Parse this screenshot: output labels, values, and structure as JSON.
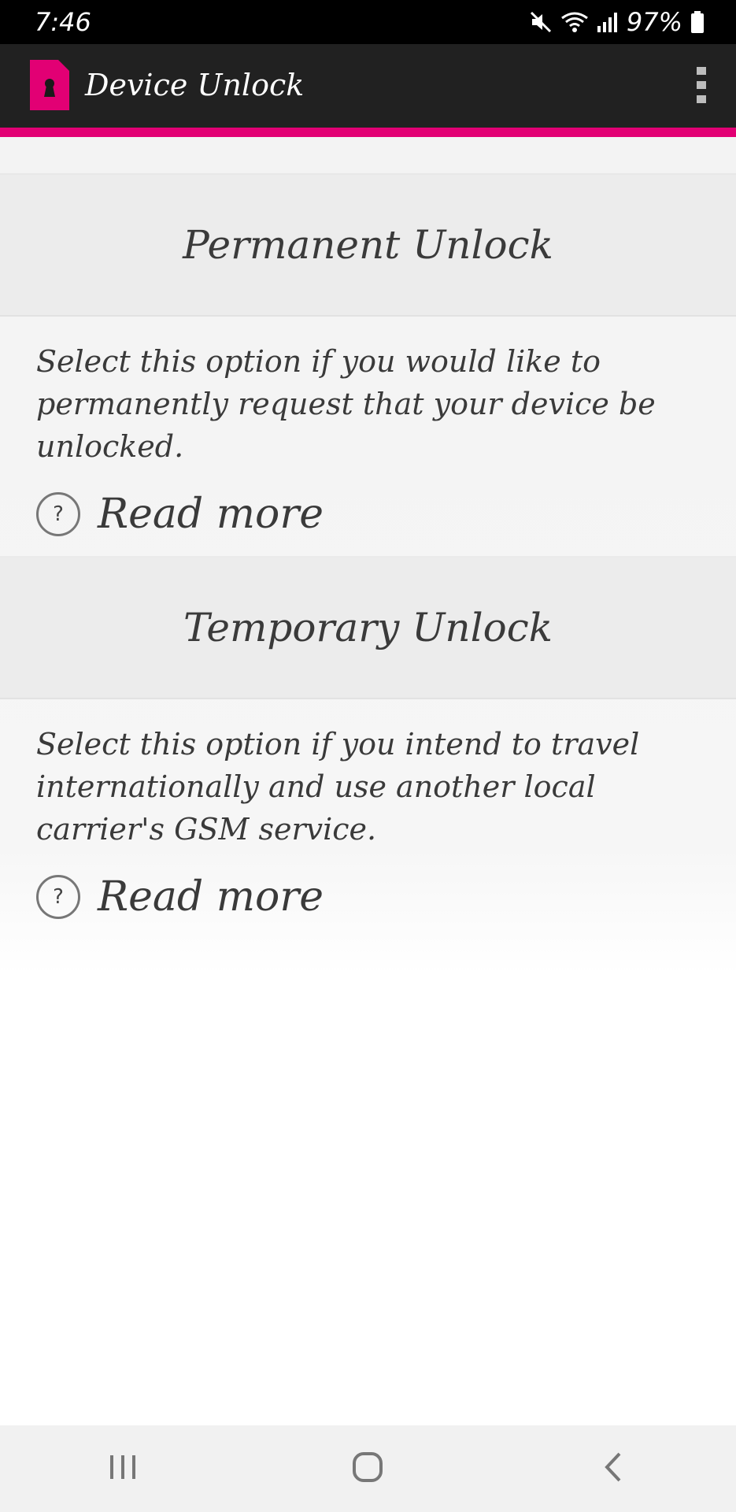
{
  "status_bar": {
    "time": "7:46",
    "battery": "97%",
    "icons": [
      "mute-icon",
      "wifi-icon",
      "signal-icon",
      "battery-icon"
    ]
  },
  "app_bar": {
    "title": "Device Unlock",
    "logo_icon": "sim-lock-icon",
    "menu_icon": "more-vert-icon"
  },
  "colors": {
    "accent": "#e20074",
    "app_bar_bg": "#212121",
    "text": "#3a3a3a"
  },
  "options": [
    {
      "title": "Permanent Unlock",
      "description": "Select this option if you would like to permanently request that your device be unlocked.",
      "read_more": "Read more"
    },
    {
      "title": "Temporary Unlock",
      "description": "Select this option if you intend to travel internationally and use another local carrier's GSM service.",
      "read_more": "Read more"
    }
  ],
  "nav_bar": {
    "icons": [
      "recent-apps-icon",
      "home-icon",
      "back-icon"
    ]
  }
}
